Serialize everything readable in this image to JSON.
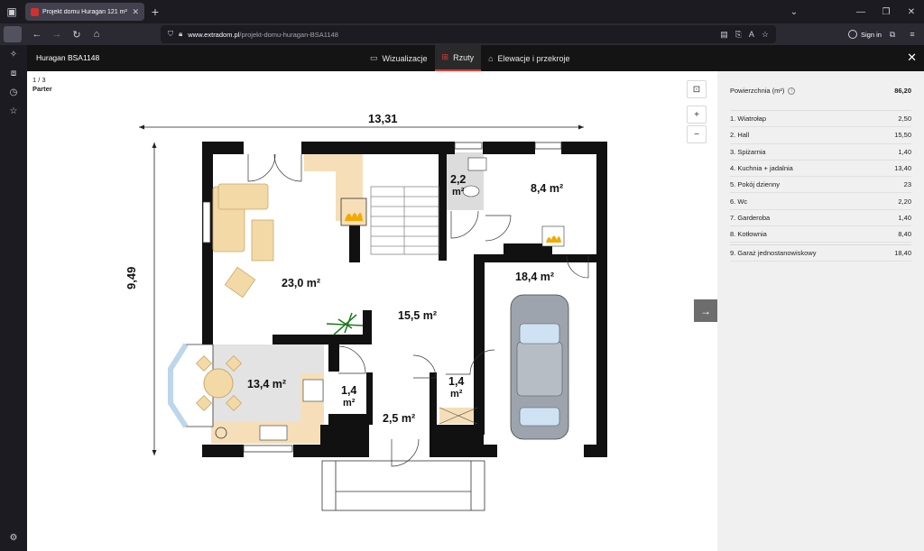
{
  "browser": {
    "tab_title": "Projekt domu Huragan 121 m²",
    "url_prefix": "www.extradom.pl",
    "url_path": "/projekt-domu-huragan-BSA1148",
    "signin_label": "Sign in"
  },
  "header": {
    "model_name": "Huragan BSA1148",
    "tabs": [
      {
        "label": "Wizualizacje",
        "icon": "monitor-icon"
      },
      {
        "label": "Rzuty",
        "icon": "floorplan-icon",
        "active": true
      },
      {
        "label": "Elewacje i przekroje",
        "icon": "house-icon"
      }
    ]
  },
  "plan": {
    "page_indicator": "1 / 3",
    "level_name": "Parter",
    "dimension_width": "13,31",
    "dimension_height": "9,49",
    "room_labels": {
      "living": "23,0 m²",
      "kitchen": "13,4 m²",
      "hall": "15,5 m²",
      "wc": "2,2",
      "wc_unit": "m²",
      "boiler": "8,4 m²",
      "garage": "18,4 m²",
      "pantry": "1,4",
      "pantry_unit": "m²",
      "wardrobe": "1,4",
      "wardrobe_unit": "m²",
      "vestibule": "2,5 m²"
    }
  },
  "rooms_panel": {
    "header_label": "Powierzchnia (m²)",
    "total": "86,20",
    "rooms": [
      {
        "name": "1. Wiatrołap",
        "area": "2,50"
      },
      {
        "name": "2. Hall",
        "area": "15,50"
      },
      {
        "name": "3. Spiżarnia",
        "area": "1,40"
      },
      {
        "name": "4. Kuchnia + jadalnia",
        "area": "13,40"
      },
      {
        "name": "5. Pokój dzienny",
        "area": "23"
      },
      {
        "name": "6. Wc",
        "area": "2,20"
      },
      {
        "name": "7. Garderoba",
        "area": "1,40"
      },
      {
        "name": "8. Kotłownia",
        "area": "8,40"
      }
    ],
    "extra_rooms": [
      {
        "name": "9. Garaż jednostanowiskowy",
        "area": "18,40"
      }
    ]
  }
}
